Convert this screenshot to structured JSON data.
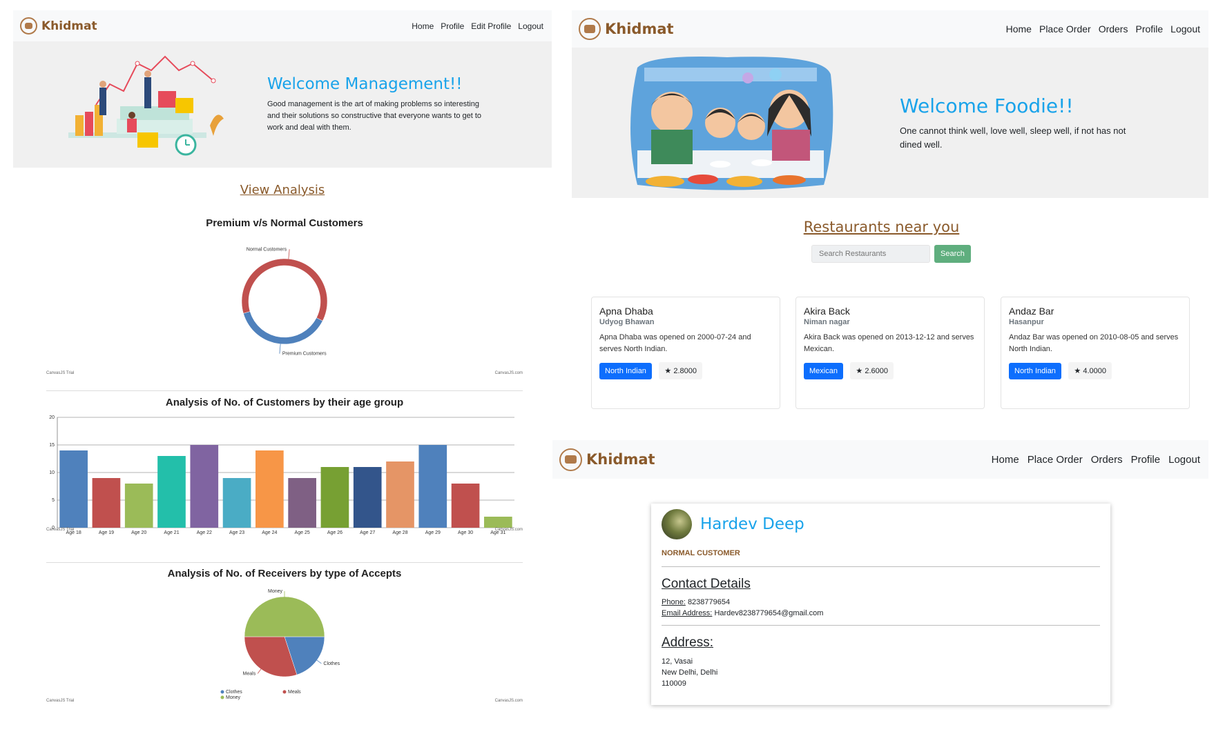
{
  "management": {
    "brand": "Khidmat",
    "nav": [
      "Home",
      "Profile",
      "Edit Profile",
      "Logout"
    ],
    "hero_title": "Welcome Management!!",
    "hero_text": "Good management is the art of making problems so interesting and their solutions so constructive that everyone wants to get to work and deal with them.",
    "section_title": "View Analysis",
    "chart_credit_left": "CanvasJS Trial",
    "chart_credit_right": "CanvasJS.com"
  },
  "chart_data": [
    {
      "type": "pie",
      "donut": true,
      "title": "Premium v/s Normal Customers",
      "labels": [
        "Normal Customers",
        "Premium Customers"
      ],
      "values": [
        62,
        38
      ],
      "colors": [
        "#c0504e",
        "#4f81bc"
      ]
    },
    {
      "type": "bar",
      "title": "Analysis of No. of Customers by their age group",
      "categories": [
        "Age 18",
        "Age 19",
        "Age 20",
        "Age 21",
        "Age 22",
        "Age 23",
        "Age 24",
        "Age 25",
        "Age 26",
        "Age 27",
        "Age 28",
        "Age 29",
        "Age 30",
        "Age 31"
      ],
      "values": [
        14,
        9,
        8,
        13,
        15,
        9,
        14,
        9,
        11,
        11,
        12,
        15,
        8,
        2
      ],
      "colors": [
        "#4f81bc",
        "#c0504e",
        "#9bbb58",
        "#23bfaa",
        "#8064a1",
        "#4aacc5",
        "#f79647",
        "#7f6084",
        "#77a033",
        "#33558b",
        "#e59566",
        "#4f81bc",
        "#c0504e",
        "#9bbb58"
      ],
      "ylim": [
        0,
        20
      ],
      "yticks": [
        0,
        5,
        10,
        15,
        20
      ],
      "grid": true
    },
    {
      "type": "pie",
      "title": "Analysis of No. of Receivers by type of Accepts",
      "labels": [
        "Clothes",
        "Meals",
        "Money"
      ],
      "values": [
        20,
        30,
        50
      ],
      "colors": [
        "#4f81bc",
        "#c0504e",
        "#9bbb58"
      ],
      "legend": "bottom"
    }
  ],
  "foodie": {
    "brand": "Khidmat",
    "nav": [
      "Home",
      "Place Order",
      "Orders",
      "Profile",
      "Logout"
    ],
    "hero_title": "Welcome Foodie!!",
    "hero_text": "One cannot think well, love well, sleep well, if not has not dined well.",
    "section_title": "Restaurants near you",
    "search_placeholder": "Search Restaurants",
    "search_button": "Search",
    "restaurants": [
      {
        "name": "Apna Dhaba",
        "location": "Udyog Bhawan",
        "description": "Apna Dhaba was opened on 2000-07-24 and serves North Indian.",
        "cuisine": "North Indian",
        "rating": "2.8000"
      },
      {
        "name": "Akira Back",
        "location": "Niman nagar",
        "description": "Akira Back was opened on 2013-12-12 and serves Mexican.",
        "cuisine": "Mexican",
        "rating": "2.6000"
      },
      {
        "name": "Andaz Bar",
        "location": "Hasanpur",
        "description": "Andaz Bar was opened on 2010-08-05 and serves North Indian.",
        "cuisine": "North Indian",
        "rating": "4.0000"
      }
    ]
  },
  "profile": {
    "brand": "Khidmat",
    "nav": [
      "Home",
      "Place Order",
      "Orders",
      "Profile",
      "Logout"
    ],
    "name": "Hardev Deep",
    "role": "NORMAL CUSTOMER",
    "contact_heading": "Contact Details",
    "phone_label": "Phone:",
    "phone": "8238779654",
    "email_label": "Email Address:",
    "email": "Hardev8238779654@gmail.com",
    "address_heading": "Address:",
    "address_lines": [
      "12, Vasai",
      "New Delhi, Delhi",
      "110009"
    ]
  },
  "colors": {
    "brand": "#8a5a2b",
    "accent": "#19a3ea",
    "primary_button": "#0d6efd",
    "search_button": "#5fae7e"
  }
}
